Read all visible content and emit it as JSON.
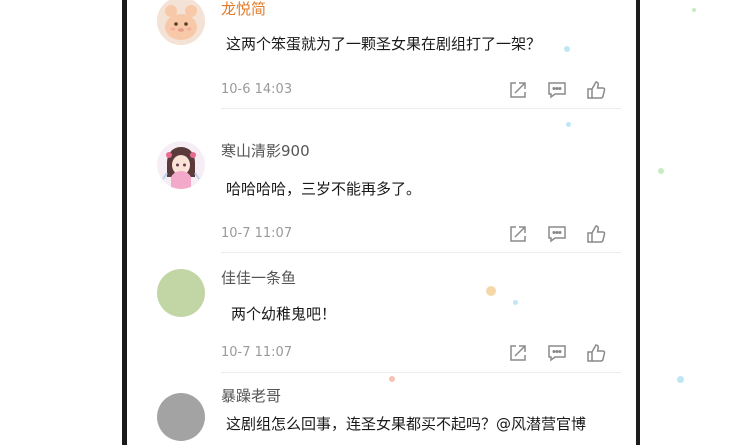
{
  "colors": {
    "name_highlight": "#e07b2a",
    "name_normal": "#555555",
    "time": "#9a9a9a",
    "icon": "#8a8a8a"
  },
  "comments": [
    {
      "name": "龙悦简",
      "text": "这两个笨蛋就为了一颗圣女果在剧组打了一架？",
      "time": "10-6 14:03",
      "avatar": "cartoon-animal-avatar"
    },
    {
      "name": "寒山清影900",
      "text": "哈哈哈哈，三岁不能再多了。",
      "time": "10-7 11:07",
      "avatar": "anime-girl-avatar"
    },
    {
      "name": "佳佳一条鱼",
      "text": "两个幼稚鬼吧！",
      "time": "10-7 11:07",
      "avatar": "green-circle-avatar"
    },
    {
      "name": "暴躁老哥",
      "text": "这剧组怎么回事，连圣女果都买不起吗？@风潜营官博",
      "avatar": "gray-circle-avatar"
    }
  ],
  "actions": {
    "share_icon": "share-icon",
    "reply_icon": "comment-icon",
    "like_icon": "thumbs-up-icon"
  }
}
